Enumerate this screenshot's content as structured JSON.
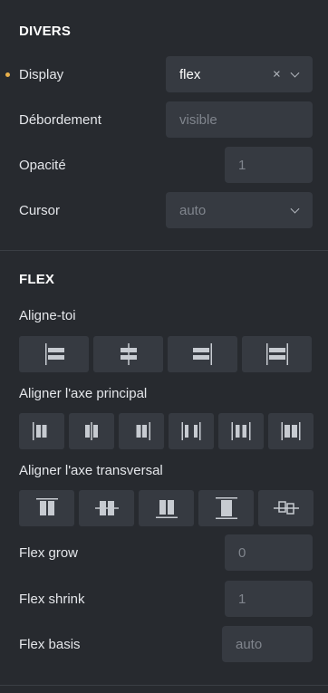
{
  "divers": {
    "title": "DIVERS",
    "display": {
      "label": "Display",
      "value": "flex",
      "modified": true
    },
    "debordement": {
      "label": "Débordement",
      "placeholder": "visible"
    },
    "opacite": {
      "label": "Opacité",
      "placeholder": "1"
    },
    "cursor": {
      "label": "Cursor",
      "placeholder": "auto"
    }
  },
  "flex": {
    "title": "FLEX",
    "align_self": {
      "label": "Aligne-toi",
      "options": [
        "align-self-start-icon",
        "align-self-center-icon",
        "align-self-end-icon",
        "align-self-stretch-icon"
      ]
    },
    "justify": {
      "label": "Aligner l'axe principal",
      "options": [
        "justify-start-icon",
        "justify-center-icon",
        "justify-end-icon",
        "justify-space-between-icon",
        "justify-space-around-icon",
        "justify-space-evenly-icon"
      ]
    },
    "align_items": {
      "label": "Aligner l'axe transversal",
      "options": [
        "align-items-start-icon",
        "align-items-center-icon",
        "align-items-end-icon",
        "align-items-stretch-icon",
        "align-items-baseline-icon"
      ]
    },
    "grow": {
      "label": "Flex grow",
      "placeholder": "0"
    },
    "shrink": {
      "label": "Flex shrink",
      "placeholder": "1"
    },
    "basis": {
      "label": "Flex basis",
      "placeholder": "auto"
    }
  },
  "colors": {
    "background": "#272a2f",
    "field": "#363a41",
    "modified_dot": "#e8b04b",
    "icon": "#c7cbd1"
  }
}
